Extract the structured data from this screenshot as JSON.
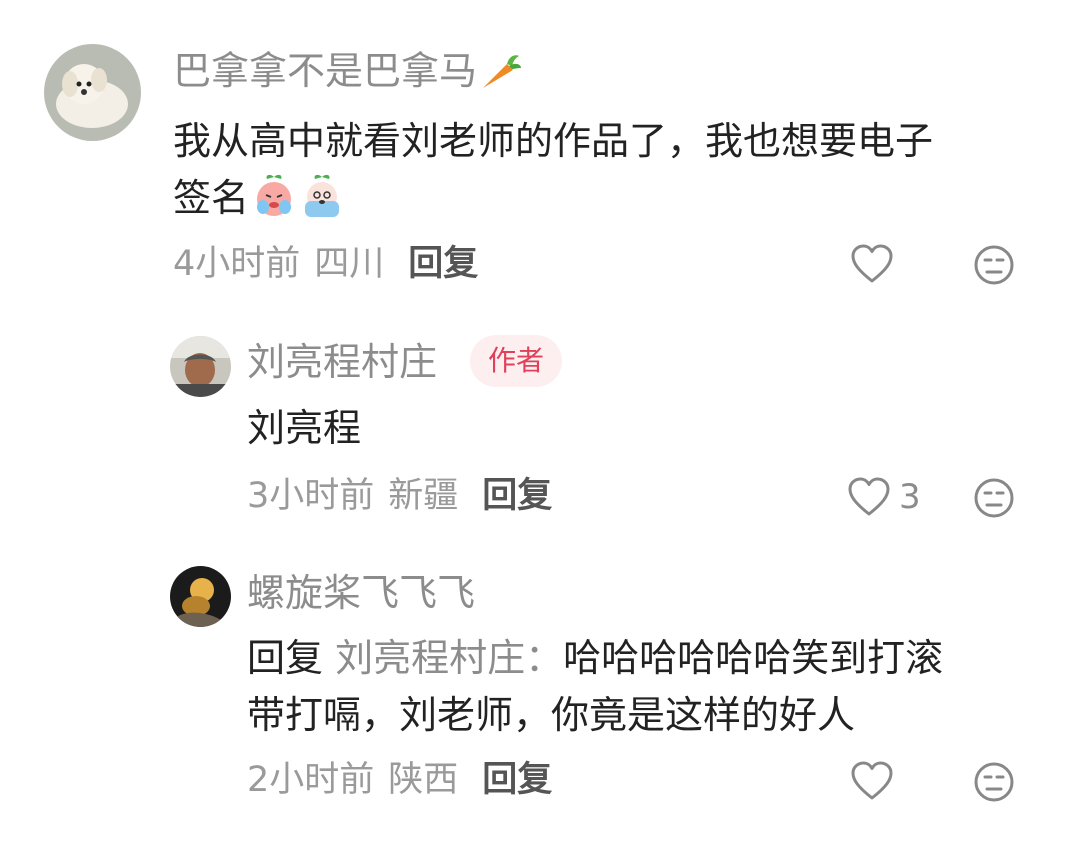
{
  "comments": [
    {
      "user": "巴拿拿不是巴拿马",
      "text_line1": "我从高中就看刘老师的作品了，我也想要电子",
      "text_line2": "签名",
      "time": "4小时前",
      "location": "四川",
      "reply_label": "回复"
    },
    {
      "user": "刘亮程村庄",
      "badge": "作者",
      "text": "刘亮程",
      "time": "3小时前",
      "location": "新疆",
      "reply_label": "回复",
      "like_count": "3"
    },
    {
      "user": "螺旋桨飞飞飞",
      "reply_prefix": "回复",
      "reply_to": "刘亮程村庄：",
      "text_line1": "哈哈哈哈哈哈笑到打滚",
      "text_line2": "带打嗝，刘老师，你竟是这样的好人",
      "time": "2小时前",
      "location": "陕西",
      "reply_label": "回复"
    }
  ],
  "icons": {
    "like": "heart-outline-icon",
    "dislike": "meh-face-icon",
    "name_emoji": "carrot-emoji",
    "text_emoji_1": "crying-peach-emoji",
    "text_emoji_2": "scared-peach-emoji"
  }
}
